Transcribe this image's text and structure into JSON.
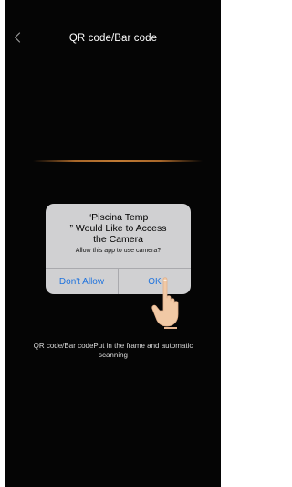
{
  "nav": {
    "title": "QR code/Bar code",
    "back_icon": "chevron-left-icon"
  },
  "alert": {
    "title": "“Piscina Temp\n” Would Like to Access\nthe Camera",
    "message": "Allow this app to use camera?",
    "deny_label": "Don't Allow",
    "ok_label": "OK"
  },
  "hint": {
    "text": "QR code/Bar codePut in the frame and automatic scanning"
  },
  "colors": {
    "screen_background": "#050505",
    "scan_line": "#c07a34",
    "alert_background": "#d0d0d2",
    "button_text": "#1f73de",
    "hand_skin": "#f1c9a5"
  },
  "icons": {
    "pointer": "pointing-hand-icon"
  }
}
